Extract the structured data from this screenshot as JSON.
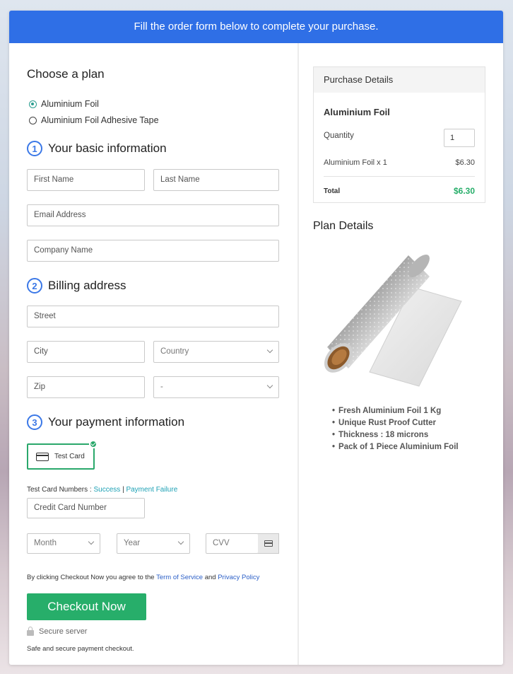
{
  "banner": {
    "text": "Fill the order form below to complete your purchase."
  },
  "plan": {
    "heading": "Choose a plan",
    "options": [
      {
        "label": "Aluminium Foil",
        "selected": true
      },
      {
        "label": "Aluminium Foil Adhesive Tape",
        "selected": false
      }
    ]
  },
  "basic": {
    "num": "1",
    "heading": "Your basic information",
    "first_name": "First Name",
    "last_name": "Last Name",
    "email": "Email Address",
    "company": "Company Name"
  },
  "billing": {
    "num": "2",
    "heading": "Billing address",
    "street": "Street",
    "city": "City",
    "country": "Country",
    "zip": "Zip",
    "state": "-"
  },
  "payment": {
    "num": "3",
    "heading": "Your payment information",
    "test_card": "Test Card",
    "test_numbers_label": "Test Card Numbers :",
    "success": "Success",
    "sep": "|",
    "failure": "Payment Failure",
    "card_number": "Credit Card Number",
    "month": "Month",
    "year": "Year",
    "cvv": "CVV"
  },
  "terms": {
    "prefix": "By clicking Checkout Now you agree to the",
    "terms_link": "Term of Service",
    "and": "and",
    "privacy_link": "Privacy Policy"
  },
  "checkout": {
    "button": "Checkout Now",
    "secure": "Secure server",
    "note": "Safe and secure payment checkout."
  },
  "purchase": {
    "heading": "Purchase Details",
    "product": "Aluminium Foil",
    "quantity_label": "Quantity",
    "quantity_value": "1",
    "line_item": "Aluminium Foil x 1",
    "line_price": "$6.30",
    "total_label": "Total",
    "total_value": "$6.30"
  },
  "plan_details": {
    "heading": "Plan Details",
    "features": [
      "Fresh Aluminium Foil 1 Kg",
      "Unique Rust Proof Cutter",
      "Thickness : 18 microns",
      "Pack of 1 Piece Aluminium Foil"
    ]
  },
  "colors": {
    "banner": "#2f6fe6",
    "accent_green": "#27ae6a",
    "step_blue": "#3b78e7",
    "link_teal": "#1ea1b5"
  }
}
